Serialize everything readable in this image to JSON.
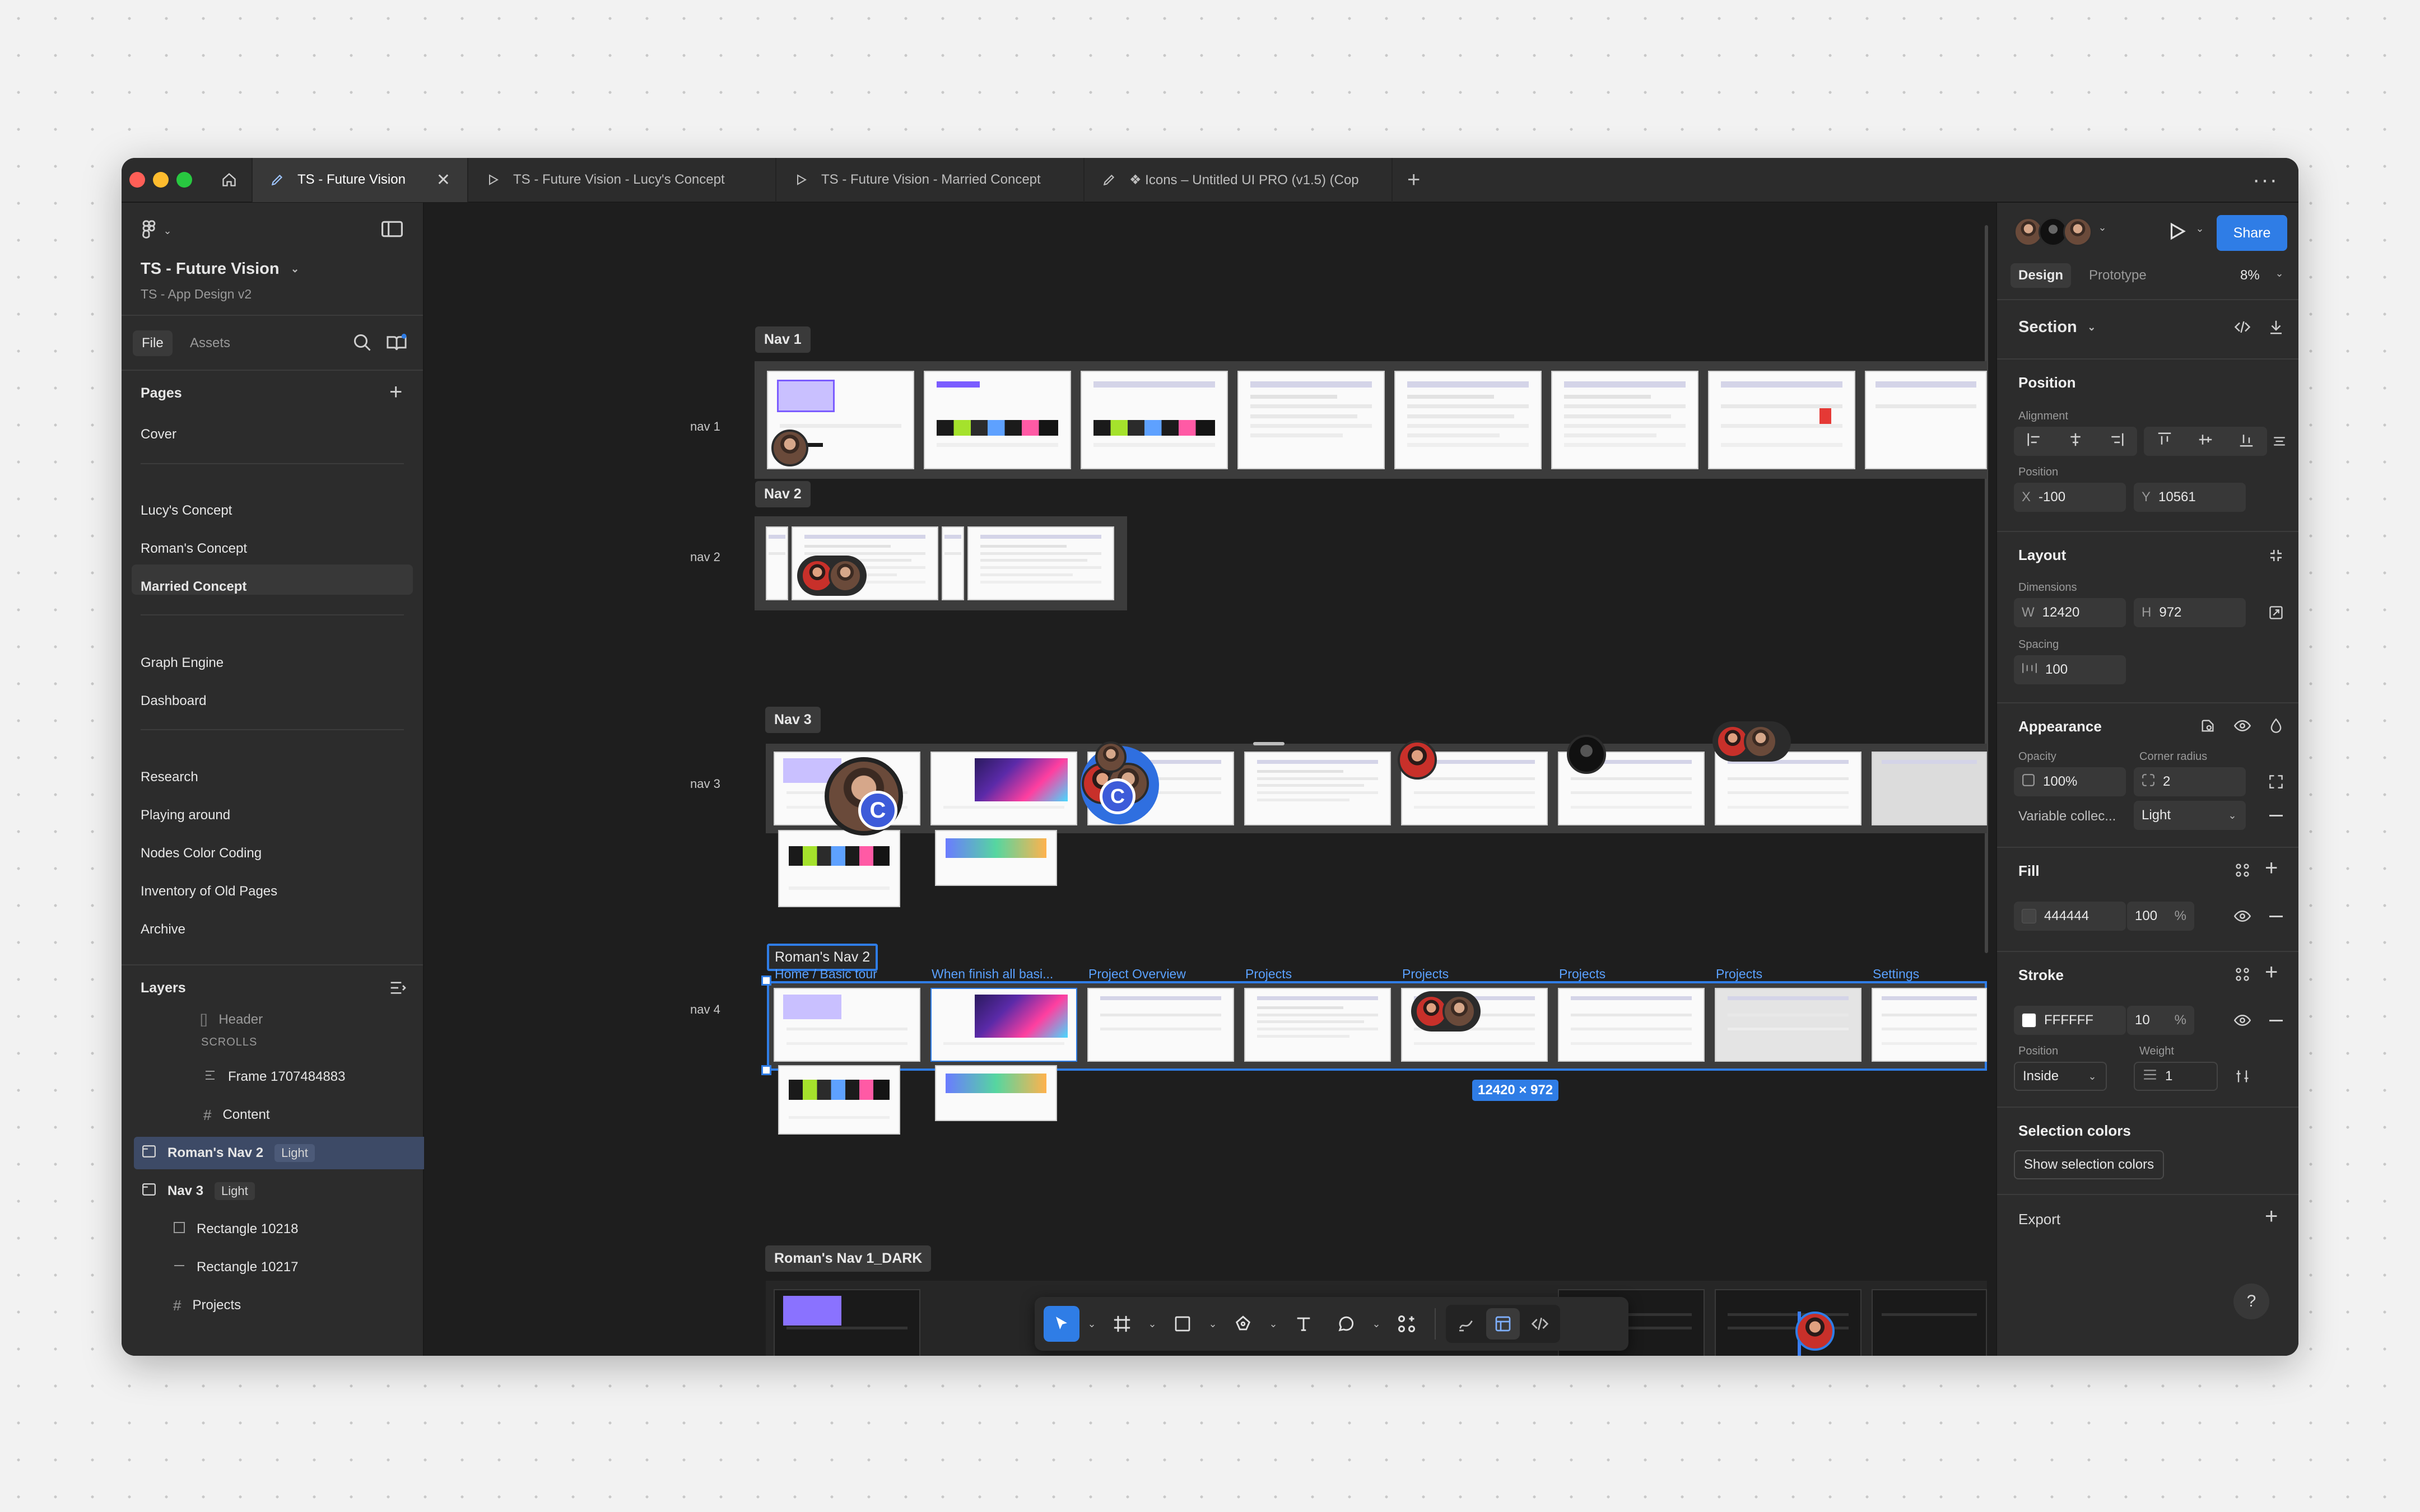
{
  "tabs": [
    {
      "label": "TS - Future Vision",
      "active": true
    },
    {
      "label": "TS - Future Vision - Lucy's Concept"
    },
    {
      "label": "TS - Future Vision - Married Concept"
    },
    {
      "label": "❖ Icons – Untitled UI PRO (v1.5) (Cop"
    }
  ],
  "file": {
    "name": "TS - Future Vision",
    "project": "TS - App Design v2"
  },
  "left_tabs": {
    "file": "File",
    "assets": "Assets"
  },
  "pages": {
    "title": "Pages",
    "items": [
      "Cover",
      "Lucy's Concept",
      "Roman's Concept",
      "Married Concept",
      "Graph Engine",
      "Dashboard",
      "Research",
      "Playing around",
      "Nodes Color Coding",
      "Inventory of Old Pages",
      "Archive"
    ],
    "selected": "Married Concept"
  },
  "layers": {
    "title": "Layers",
    "items": [
      {
        "name": "Header"
      },
      {
        "name": "SCROLLS"
      },
      {
        "name": "Frame 1707484883"
      },
      {
        "name": "Content"
      },
      {
        "name": "Roman's Nav 2",
        "badge": "Light"
      },
      {
        "name": "Nav 3",
        "badge": "Light"
      },
      {
        "name": "Rectangle 10218"
      },
      {
        "name": "Rectangle 10217"
      },
      {
        "name": "Projects"
      }
    ]
  },
  "canvas": {
    "sections": {
      "nav1": "Nav 1",
      "nav2": "Nav 2",
      "nav3": "Nav 3",
      "romans_nav2": "Roman's Nav 2",
      "romans_nav1_dark": "Roman's Nav 1_DARK"
    },
    "row_labels": {
      "r1": "nav 1",
      "r2": "nav 2",
      "r3": "nav 3",
      "r4": "nav 4"
    },
    "frame_captions": [
      "Home / Basic tour",
      "When finish all basi...",
      "Project Overview",
      "Projects",
      "Projects",
      "Projects",
      "Projects",
      "Settings"
    ],
    "size_badge": "12420 × 972",
    "cursor_letter": "C"
  },
  "right": {
    "share": "Share",
    "tabs": {
      "design": "Design",
      "prototype": "Prototype"
    },
    "zoom": "8%",
    "section_title": "Section",
    "position": {
      "title": "Position",
      "alignment": "Alignment",
      "label": "Position",
      "x": "-100",
      "y": "10561"
    },
    "layout": {
      "title": "Layout",
      "dimensions": "Dimensions",
      "w": "12420",
      "h": "972",
      "spacing": "Spacing",
      "spacing_value": "100"
    },
    "appearance": {
      "title": "Appearance",
      "opacity_label": "Opacity",
      "opacity": "100%",
      "radius_label": "Corner radius",
      "radius": "2",
      "variable_label": "Variable collec...",
      "variable_value": "Light"
    },
    "fill": {
      "title": "Fill",
      "hex": "444444",
      "opacity": "100",
      "unit": "%",
      "color": "#444444"
    },
    "stroke": {
      "title": "Stroke",
      "hex": "FFFFFF",
      "opacity": "10",
      "unit": "%",
      "position_label": "Position",
      "position": "Inside",
      "weight_label": "Weight",
      "weight": "1",
      "color": "#FFFFFF"
    },
    "selection_colors": {
      "title": "Selection colors",
      "button": "Show selection colors"
    },
    "export": {
      "title": "Export"
    },
    "axis": {
      "x": "X",
      "y": "Y",
      "w": "W",
      "h": "H"
    }
  },
  "colors": {
    "accent": "#2f7de6",
    "bg": "#1e1e1e",
    "panel": "#2c2c2c"
  }
}
